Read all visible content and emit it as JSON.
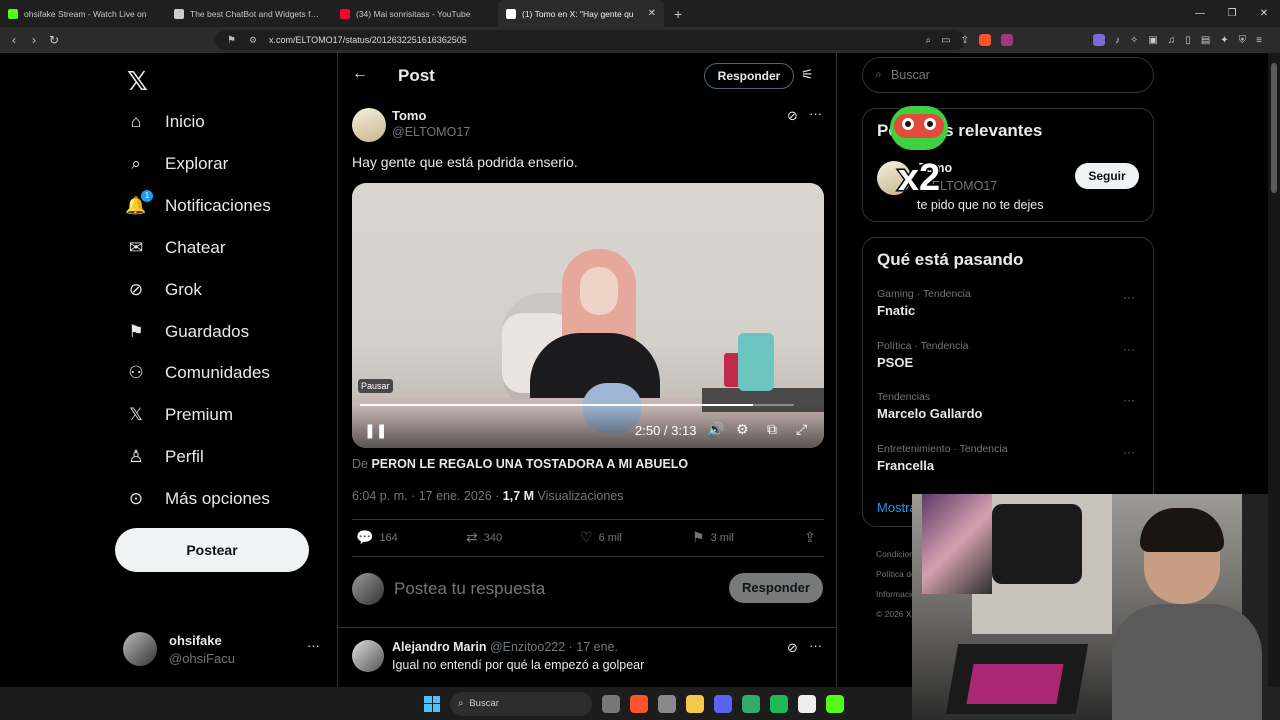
{
  "browser": {
    "tabs": [
      {
        "label": "ohsifake Stream - Watch Live on",
        "color": "#53fc18"
      },
      {
        "label": "The best ChatBot and Widgets for Ki",
        "color": "#cccccc"
      },
      {
        "label": "(34) Mai sonrisitass - YouTube",
        "color": "#ff0033"
      },
      {
        "label": "(1) Tomo en X: \"Hay gente qu",
        "color": "#ffffff"
      }
    ],
    "url": "x.com/ELTOMO17/status/2012632251616362505"
  },
  "nav": {
    "items": [
      {
        "label": "Inicio",
        "icon": "home-icon",
        "glyph": "⌂"
      },
      {
        "label": "Explorar",
        "icon": "search-icon",
        "glyph": "⌕"
      },
      {
        "label": "Notificaciones",
        "icon": "bell-icon",
        "glyph": "🔔"
      },
      {
        "label": "Chatear",
        "icon": "mail-icon",
        "glyph": "✉"
      },
      {
        "label": "Grok",
        "icon": "grok-icon",
        "glyph": "⊘"
      },
      {
        "label": "Guardados",
        "icon": "bookmark-icon",
        "glyph": "⚑"
      },
      {
        "label": "Comunidades",
        "icon": "people-icon",
        "glyph": "⚇"
      },
      {
        "label": "Premium",
        "icon": "x-icon",
        "glyph": "𝕏"
      },
      {
        "label": "Perfil",
        "icon": "person-icon",
        "glyph": "♙"
      },
      {
        "label": "Más opciones",
        "icon": "more-circle-icon",
        "glyph": "⊙"
      }
    ],
    "notification_badge": "1",
    "post_label": "Postear",
    "account": {
      "name": "ohsifake",
      "handle": "@ohsiFacu"
    }
  },
  "header": {
    "title": "Post",
    "reply_label": "Responder"
  },
  "tweet": {
    "name": "Tomo",
    "handle": "@ELTOMO17",
    "text": "Hay gente que está podrida enserio.",
    "video": {
      "tooltip": "Pausar",
      "time": "2:50 / 3:13",
      "progress": 0.906
    },
    "from_prefix": "De",
    "from_title": "PERON LE REGALO UNA TOSTADORA A MI ABUELO",
    "timestamp": "6:04 p. m. · 17 ene. 2026 · ",
    "views_count": "1,7 M",
    "views_label": " Visualizaciones",
    "actions": {
      "replies": "164",
      "reposts": "340",
      "likes": "6 mil",
      "bookmarks": "3 mil"
    }
  },
  "reply_box": {
    "placeholder": "Postea tu respuesta",
    "button": "Responder"
  },
  "comment": {
    "name": "Alejandro Marin",
    "meta": " @Enzitoo222 · 17 ene.",
    "text": "Igual no entendí por qué la empezó a golpear"
  },
  "sidebar": {
    "search_placeholder": "Buscar",
    "relevant": {
      "title": "Personas relevantes",
      "name": "Tomo",
      "handle": "@ELTOMO17",
      "bio": "te pido que no te dejes",
      "follow": "Seguir"
    },
    "trends_title": "Qué está pasando",
    "trends": [
      {
        "category": "Gaming · Tendencia",
        "name": "Fnatic"
      },
      {
        "category": "Política · Tendencia",
        "name": "PSOE"
      },
      {
        "category": "Tendencias",
        "name": "Marcelo Gallardo"
      },
      {
        "category": "Entretenimiento · Tendencia",
        "name": "Francella"
      }
    ],
    "show_more": "Mostrar más",
    "footer": [
      "Condiciones",
      "Política de",
      "Información",
      "© 2026 X"
    ]
  },
  "taskbar": {
    "search": "Buscar"
  }
}
